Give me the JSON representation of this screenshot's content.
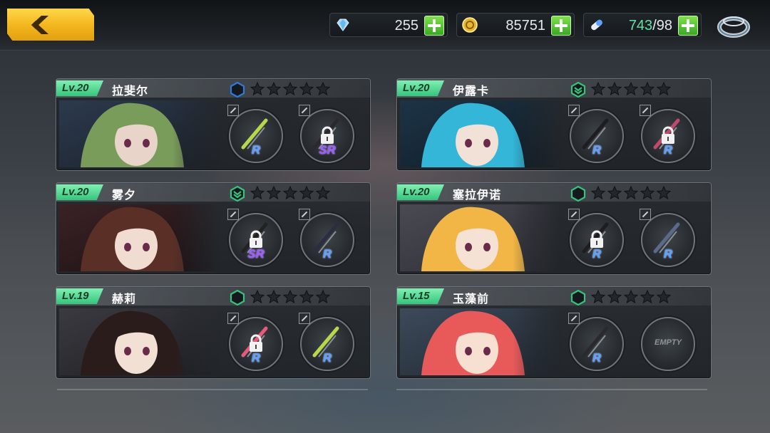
{
  "currency": {
    "gems": "255",
    "gold": "85751",
    "stamina_current": "743",
    "stamina_max": "/98"
  },
  "characters": [
    {
      "level": "Lv.20",
      "name": "拉斐尔",
      "rank_color": "#2f7bd8",
      "rank_shape": "hexagon",
      "slots": [
        {
          "grade": "R",
          "locked": false
        },
        {
          "grade": "SR",
          "locked": true
        }
      ]
    },
    {
      "level": "Lv.20",
      "name": "伊露卡",
      "rank_color": "#36c47c",
      "rank_shape": "chevron",
      "slots": [
        {
          "grade": "R",
          "locked": false
        },
        {
          "grade": "R",
          "locked": true
        }
      ]
    },
    {
      "level": "Lv.20",
      "name": "雾夕",
      "rank_color": "#36c47c",
      "rank_shape": "chevron",
      "slots": [
        {
          "grade": "SR",
          "locked": true
        },
        {
          "grade": "R",
          "locked": false
        }
      ]
    },
    {
      "level": "Lv.20",
      "name": "塞拉伊诺",
      "rank_color": "#36c47c",
      "rank_shape": "hexagon",
      "slots": [
        {
          "grade": "R",
          "locked": true
        },
        {
          "grade": "R",
          "locked": false
        }
      ]
    },
    {
      "level": "Lv.19",
      "name": "赫莉",
      "rank_color": "#36c47c",
      "rank_shape": "hexagon",
      "slots": [
        {
          "grade": "R",
          "locked": true
        },
        {
          "grade": "R",
          "locked": false
        }
      ]
    },
    {
      "level": "Lv.15",
      "name": "玉藻前",
      "rank_color": "#36c47c",
      "rank_shape": "hexagon",
      "slots": [
        {
          "grade": "R",
          "locked": false
        },
        {
          "empty_label": "EMPTY"
        }
      ]
    }
  ],
  "stars_per_card": 5,
  "colors": {
    "accent_yellow": "#f2b51c",
    "level_green": "#36c47c",
    "plus_green": "#3aa824",
    "grade_r": "#5aa0ff",
    "grade_sr": "#9b5cff"
  }
}
